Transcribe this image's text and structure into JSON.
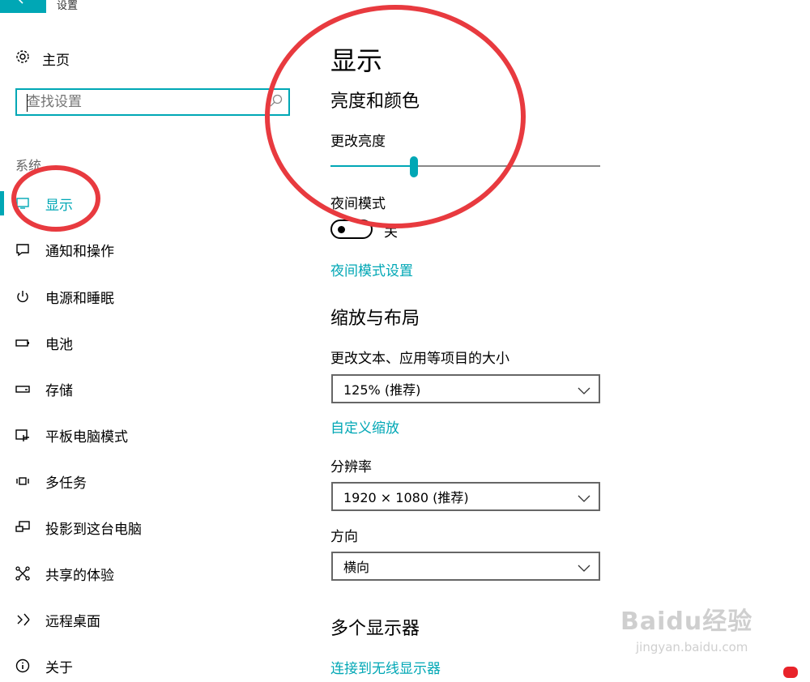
{
  "window": {
    "title": "设置",
    "back_icon": "back-arrow-icon"
  },
  "sidebar": {
    "home_label": "主页",
    "search_placeholder": "查找设置",
    "section_label": "系统",
    "items": [
      {
        "label": "显示",
        "icon": "display-icon",
        "active": true
      },
      {
        "label": "通知和操作",
        "icon": "notification-icon"
      },
      {
        "label": "电源和睡眠",
        "icon": "power-icon"
      },
      {
        "label": "电池",
        "icon": "battery-icon"
      },
      {
        "label": "存储",
        "icon": "storage-icon"
      },
      {
        "label": "平板电脑模式",
        "icon": "tablet-mode-icon"
      },
      {
        "label": "多任务",
        "icon": "multitask-icon"
      },
      {
        "label": "投影到这台电脑",
        "icon": "project-icon"
      },
      {
        "label": "共享的体验",
        "icon": "shared-experience-icon"
      },
      {
        "label": "远程桌面",
        "icon": "remote-desktop-icon"
      },
      {
        "label": "关于",
        "icon": "info-icon"
      }
    ]
  },
  "main": {
    "title": "显示",
    "brightness_heading": "亮度和颜色",
    "brightness_label": "更改亮度",
    "brightness_value": 0.31,
    "night_mode_label": "夜间模式",
    "night_mode_state": "关",
    "night_mode_link": "夜间模式设置",
    "scale_heading": "缩放与布局",
    "scale_label": "更改文本、应用等项目的大小",
    "scale_value": "125% (推荐)",
    "custom_scale_link": "自定义缩放",
    "resolution_label": "分辨率",
    "resolution_value": "1920 × 1080 (推荐)",
    "orientation_label": "方向",
    "orientation_value": "横向",
    "multi_display_heading": "多个显示器",
    "wireless_link": "连接到无线显示器"
  },
  "watermark": {
    "text": "Baidu经验",
    "sub": "jingyan.baidu.com"
  },
  "colors": {
    "accent": "#00a7b5",
    "annotation": "#e83a3f"
  }
}
